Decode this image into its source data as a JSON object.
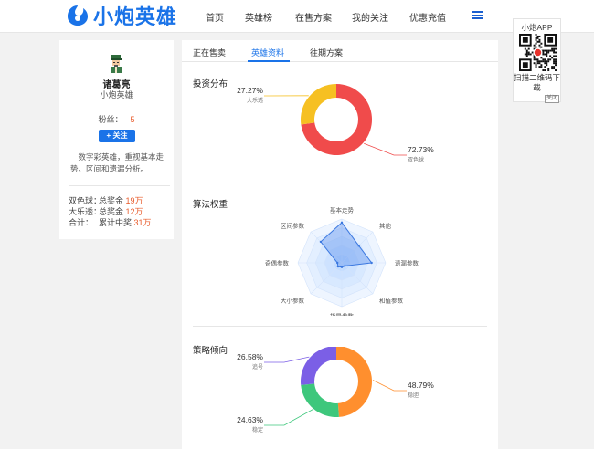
{
  "header": {
    "logo_text": "小炮英雄",
    "nav": [
      {
        "label": "首页"
      },
      {
        "label": "英雄榜"
      },
      {
        "label": "在售方案"
      },
      {
        "label": "我的关注"
      },
      {
        "label": "优惠充值"
      }
    ]
  },
  "profile": {
    "name": "诸葛亮",
    "title": "小炮英雄",
    "fans_label": "粉丝：",
    "fans_count": "5",
    "follow_label": "+ 关注",
    "description": "数字彩英雄，重视基本走势、区间和遗漏分析。",
    "stats": [
      {
        "key": "双色球：",
        "label": "总奖金",
        "value": "19万"
      },
      {
        "key": "大乐透：",
        "label": "总奖金",
        "value": "12万"
      },
      {
        "key": "合计：",
        "label": "累计中奖",
        "value": "31万"
      }
    ]
  },
  "tabs": [
    {
      "label": "正在售卖",
      "active": false
    },
    {
      "label": "英雄资料",
      "active": true
    },
    {
      "label": "往期方案",
      "active": false
    }
  ],
  "sections": {
    "investment": "投资分布",
    "algorithm": "算法权重",
    "strategy": "策略倾向"
  },
  "charts": {
    "investment": {
      "type": "pie",
      "slices": [
        {
          "name": "双色球",
          "value": 72.73,
          "label": "72.73%",
          "color": "#f04b4b"
        },
        {
          "name": "大乐透",
          "value": 27.27,
          "label": "27.27%",
          "color": "#f6c022"
        }
      ]
    },
    "algorithm": {
      "type": "radar",
      "axes": [
        "基本走势",
        "其他",
        "遗漏参数",
        "和值参数",
        "指导参数",
        "大小参数",
        "奇偶参数",
        "区间参数"
      ],
      "values": [
        0.92,
        0.55,
        0.68,
        0.1,
        0.1,
        0.12,
        0.1,
        0.68
      ],
      "max": 1
    },
    "strategy": {
      "type": "pie",
      "slices": [
        {
          "name": "稳胆",
          "value": 48.79,
          "label": "48.79%",
          "color": "#ff8f2e"
        },
        {
          "name": "稳定",
          "value": 24.63,
          "label": "24.63%",
          "color": "#3ec77c"
        },
        {
          "name": "追号",
          "value": 26.58,
          "label": "26.58%",
          "color": "#7b5fe6"
        }
      ]
    }
  },
  "qr": {
    "title": "小炮APP",
    "desc": "扫描二维码下载",
    "close": "关闭"
  },
  "colors": {
    "accent": "#1a73e8",
    "highlight": "#e85a2a"
  }
}
